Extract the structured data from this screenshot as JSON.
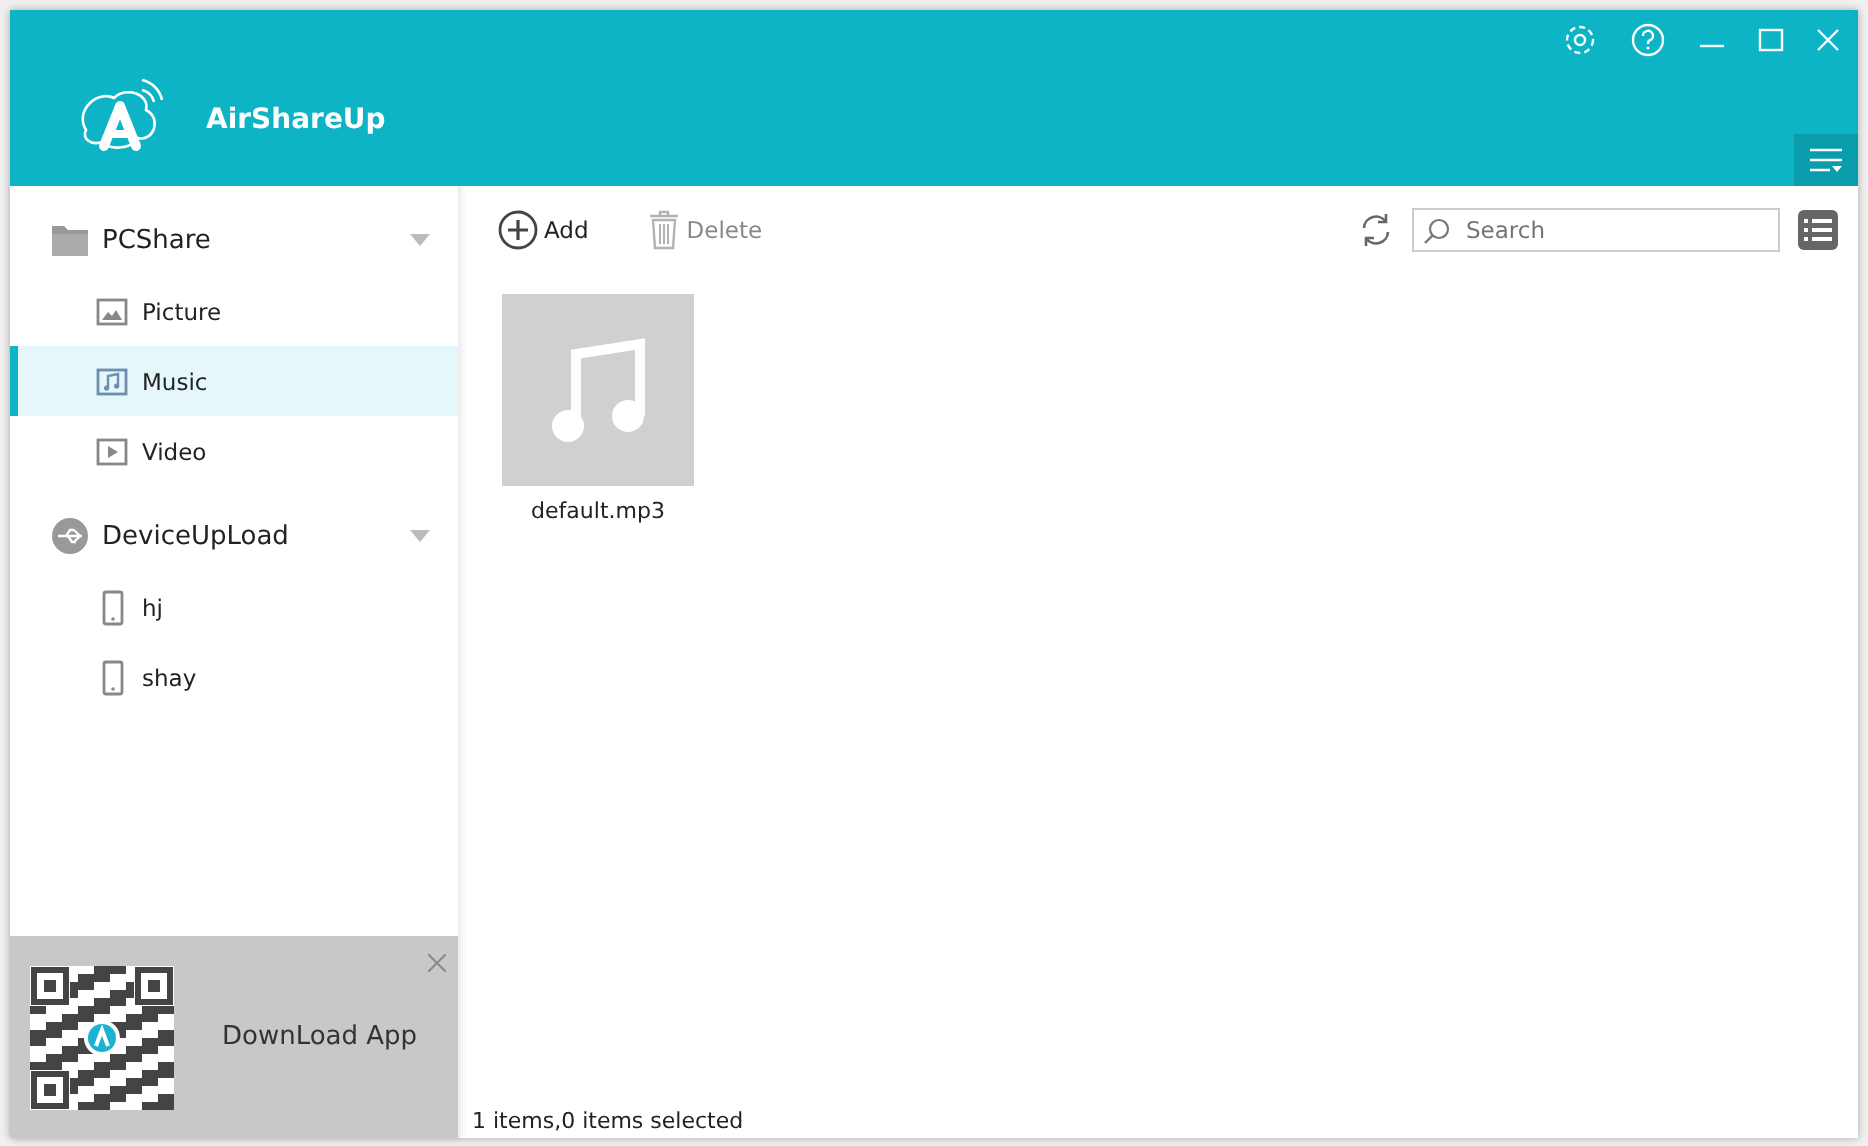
{
  "window": {
    "title": "AirShareUp"
  },
  "sidebar": {
    "groups": [
      {
        "label": "PCShare",
        "kind": "folder",
        "expanded": true,
        "children": [
          {
            "label": "Picture",
            "kind": "picture",
            "selected": false
          },
          {
            "label": "Music",
            "kind": "music",
            "selected": true
          },
          {
            "label": "Video",
            "kind": "video",
            "selected": false
          }
        ]
      },
      {
        "label": "DeviceUpLoad",
        "kind": "usb",
        "expanded": true,
        "children": [
          {
            "label": "hj",
            "kind": "phone",
            "selected": false
          },
          {
            "label": "shay",
            "kind": "phone",
            "selected": false
          }
        ]
      }
    ],
    "promo": {
      "label": "DownLoad App"
    }
  },
  "toolbar": {
    "buttons": [
      {
        "label": "Add",
        "kind": "add",
        "disabled": false
      },
      {
        "label": "Delete",
        "kind": "delete",
        "disabled": true
      }
    ],
    "search": {
      "placeholder": "Search"
    }
  },
  "files": [
    {
      "name": "default.mp3",
      "kind": "music"
    }
  ],
  "status_bar": "1 items,0 items selected"
}
